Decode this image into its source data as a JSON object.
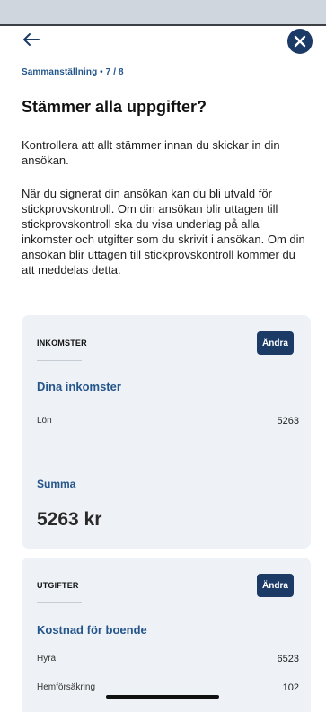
{
  "nav": {
    "back_icon": "arrow-left-icon",
    "close_icon": "close-icon"
  },
  "colors": {
    "accent": "#24568c",
    "button_bg": "#1b3a66",
    "card_bg": "#eef1f5",
    "status_strip": "#cfd6de"
  },
  "header": {
    "step": "Sammanställning • 7 / 8",
    "title": "Stämmer alla uppgifter?"
  },
  "intro": {
    "paragraph1": "Kontrollera att allt stämmer innan du skickar in din ansökan.",
    "paragraph2": "När du signerat din ansökan kan du bli utvald för stickprovskontroll. Om din ansökan blir uttagen till stickprovskontroll ska du visa underlag på alla inkomster och utgifter som du skrivit i ansökan. Om din ansökan blir uttagen till stickprovskontroll kommer du att meddelas detta."
  },
  "income": {
    "label": "INKOMSTER",
    "edit_label": "Ändra",
    "section_title": "Dina inkomster",
    "rows": [
      {
        "label": "Lön",
        "value": "5263"
      }
    ],
    "sum_title": "Summa",
    "sum_value": "5263 kr"
  },
  "expenses": {
    "label": "UTGIFTER",
    "edit_label": "Ändra",
    "section_title": "Kostnad för boende",
    "rows": [
      {
        "label": "Hyra",
        "value": "6523"
      },
      {
        "label": "Hemförsäkring",
        "value": "102"
      }
    ]
  }
}
